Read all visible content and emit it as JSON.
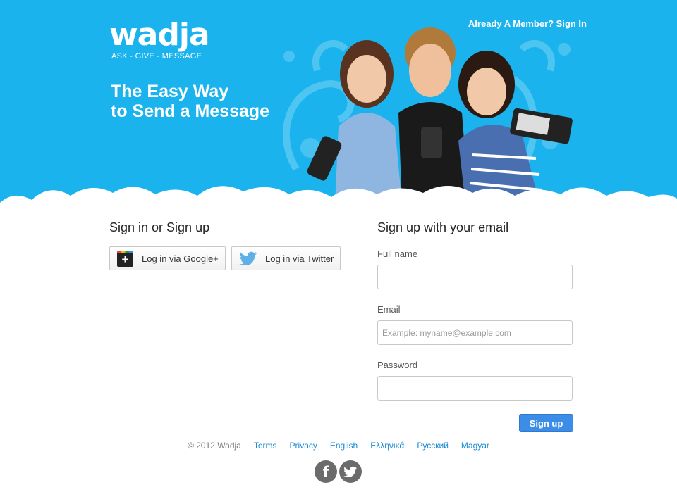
{
  "brand": {
    "logo": "wadja",
    "tagline": "ASK - GIVE - MESSAGE",
    "headline_line1": "The Easy Way",
    "headline_line2": "to Send a Message"
  },
  "header": {
    "member_link": "Already A Member? Sign In"
  },
  "signin": {
    "title": "Sign in or Sign up",
    "google_label": "Log in via Google+",
    "twitter_label": "Log in via Twitter"
  },
  "signup": {
    "title": "Sign up with your email",
    "fullname_label": "Full name",
    "fullname_value": "",
    "email_label": "Email",
    "email_placeholder": "Example: myname@example.com",
    "password_label": "Password",
    "password_value": "",
    "button_label": "Sign up"
  },
  "footer": {
    "copyright": "© 2012 Wadja",
    "links": [
      "Terms",
      "Privacy",
      "English",
      "Ελληνικά",
      "Русский",
      "Magyar"
    ],
    "facebook_glyph": "f",
    "social_icons": [
      "facebook-icon",
      "twitter-icon"
    ]
  },
  "colors": {
    "hero_bg": "#1ab3ee",
    "link": "#1a8ad3",
    "button": "#3b8de8"
  }
}
